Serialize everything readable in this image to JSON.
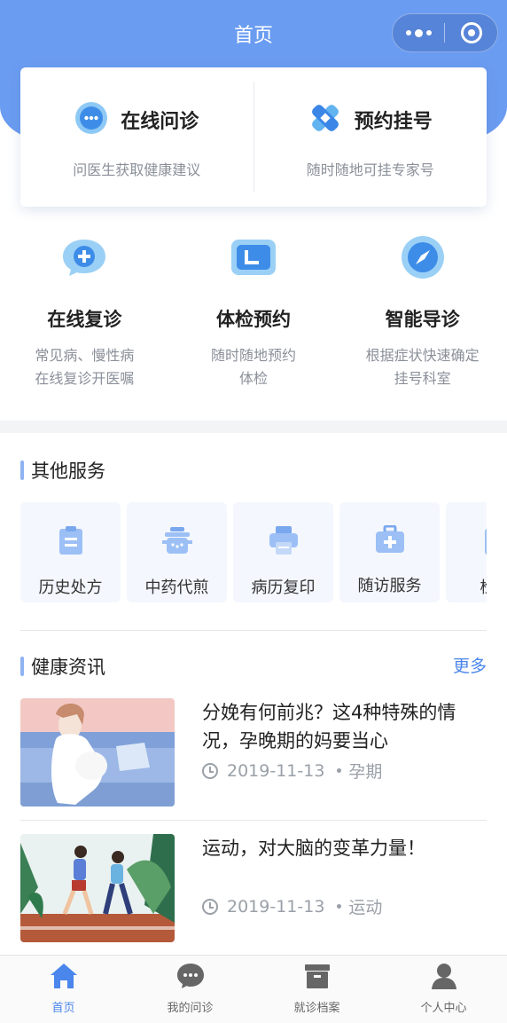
{
  "header": {
    "title": "首页"
  },
  "top_services": [
    {
      "title": "在线问诊",
      "subtitle": "问医生获取健康建议",
      "icon": "chat-icon"
    },
    {
      "title": "预约挂号",
      "subtitle": "随时随地可挂专家号",
      "icon": "medical-cross-icon"
    }
  ],
  "main_services": [
    {
      "title": "在线复诊",
      "desc_line1": "常见病、慢性病",
      "desc_line2": "在线复诊开医嘱",
      "icon": "chat-plus-icon"
    },
    {
      "title": "体检预约",
      "desc_line1": "随时随地预约",
      "desc_line2": "体检",
      "icon": "calendar-icon"
    },
    {
      "title": "智能导诊",
      "desc_line1": "根据症状快速确定",
      "desc_line2": "挂号科室",
      "icon": "compass-icon"
    }
  ],
  "other_services": {
    "title": "其他服务",
    "items": [
      {
        "label": "历史处方",
        "icon": "clipboard-icon"
      },
      {
        "label": "中药代煎",
        "icon": "pot-icon"
      },
      {
        "label": "病历复印",
        "icon": "printer-icon"
      },
      {
        "label": "随访服务",
        "icon": "medkit-icon"
      },
      {
        "label": "检查",
        "icon": "report-icon"
      }
    ]
  },
  "news": {
    "title": "健康资讯",
    "more_label": "更多",
    "items": [
      {
        "title": "分娩有何前兆？这4种特殊的情况，孕晚期的妈要当心",
        "date": "2019-11-13",
        "tag": "孕期"
      },
      {
        "title": "运动，对大脑的变革力量！",
        "date": "2019-11-13",
        "tag": "运动"
      }
    ]
  },
  "tabbar": [
    {
      "label": "首页",
      "icon": "home-icon",
      "active": true
    },
    {
      "label": "我的问诊",
      "icon": "chat-bubble-icon",
      "active": false
    },
    {
      "label": "就诊档案",
      "icon": "archive-box-icon",
      "active": false
    },
    {
      "label": "个人中心",
      "icon": "user-icon",
      "active": false
    }
  ],
  "colors": {
    "primary": "#6a9cf1",
    "accent": "#4a86ec",
    "tile_bg": "#f4f7fd"
  }
}
